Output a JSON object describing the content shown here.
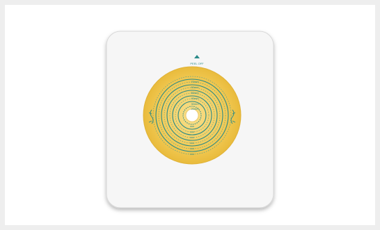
{
  "image": {
    "subject": "ostomy-skin-barrier-wafer",
    "colors": {
      "background": "#eeeeee",
      "frame": "#ffffff",
      "backing": "#f4f4f4",
      "hydrocolloid": "#f0c64a",
      "hydrocolloid_light": "#f7dc83",
      "guide_lines": "#2a8a88"
    },
    "printed_text": {
      "top_label": "PEEL OFF",
      "ring_labels": [
        "70mm",
        "60mm",
        "50mm",
        "40mm",
        "30mm",
        "20mm"
      ]
    }
  }
}
